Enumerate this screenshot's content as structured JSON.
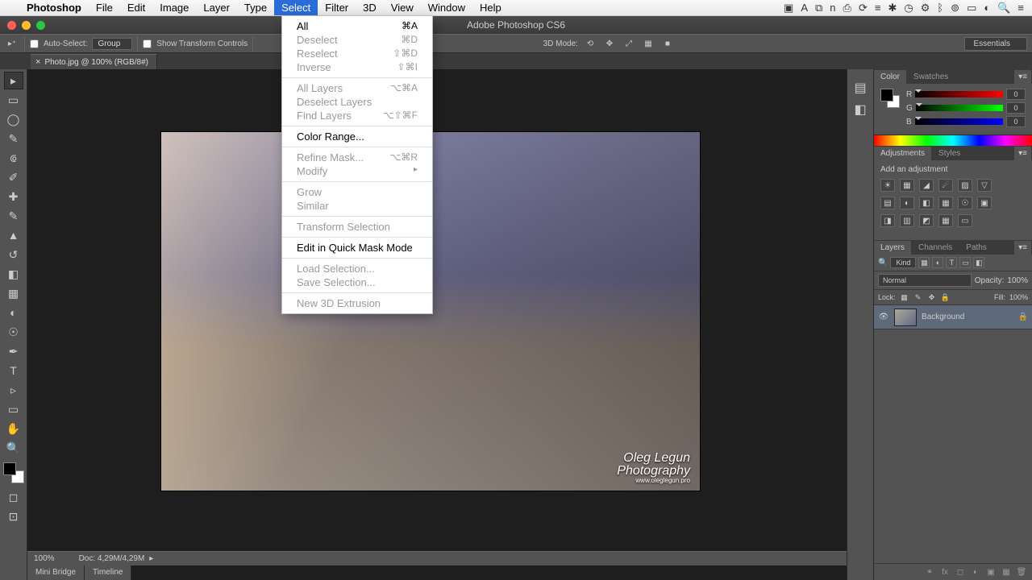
{
  "menubar": {
    "app": "Photoshop",
    "items": [
      "File",
      "Edit",
      "Image",
      "Layer",
      "Type",
      "Select",
      "Filter",
      "3D",
      "View",
      "Window",
      "Help"
    ],
    "active_index": 5
  },
  "dropdown": {
    "groups": [
      [
        {
          "label": "All",
          "shortcut": "⌘A",
          "enabled": true
        },
        {
          "label": "Deselect",
          "shortcut": "⌘D",
          "enabled": false
        },
        {
          "label": "Reselect",
          "shortcut": "⇧⌘D",
          "enabled": false
        },
        {
          "label": "Inverse",
          "shortcut": "⇧⌘I",
          "enabled": false
        }
      ],
      [
        {
          "label": "All Layers",
          "shortcut": "⌥⌘A",
          "enabled": false
        },
        {
          "label": "Deselect Layers",
          "shortcut": "",
          "enabled": false
        },
        {
          "label": "Find Layers",
          "shortcut": "⌥⇧⌘F",
          "enabled": false
        }
      ],
      [
        {
          "label": "Color Range...",
          "shortcut": "",
          "enabled": true
        }
      ],
      [
        {
          "label": "Refine Mask...",
          "shortcut": "⌥⌘R",
          "enabled": false
        },
        {
          "label": "Modify",
          "shortcut": "",
          "enabled": false,
          "submenu": true
        }
      ],
      [
        {
          "label": "Grow",
          "shortcut": "",
          "enabled": false
        },
        {
          "label": "Similar",
          "shortcut": "",
          "enabled": false
        }
      ],
      [
        {
          "label": "Transform Selection",
          "shortcut": "",
          "enabled": false
        }
      ],
      [
        {
          "label": "Edit in Quick Mask Mode",
          "shortcut": "",
          "enabled": true
        }
      ],
      [
        {
          "label": "Load Selection...",
          "shortcut": "",
          "enabled": false
        },
        {
          "label": "Save Selection...",
          "shortcut": "",
          "enabled": false
        }
      ],
      [
        {
          "label": "New 3D Extrusion",
          "shortcut": "",
          "enabled": false
        }
      ]
    ]
  },
  "window_title": "Adobe Photoshop CS6",
  "options": {
    "auto_select": "Auto-Select:",
    "group": "Group",
    "show_transform": "Show Transform Controls",
    "mode_3d": "3D Mode:",
    "workspace": "Essentials"
  },
  "document_tab": {
    "close": "×",
    "label": "Photo.jpg @ 100% (RGB/8#)"
  },
  "watermark": {
    "line1": "Oleg Legun",
    "line2": "Photography",
    "line3": "www.oleglegun.pro"
  },
  "status": {
    "zoom": "100%",
    "doc": "Doc: 4,29M/4,29M"
  },
  "bottom_tabs": [
    "Mini Bridge",
    "Timeline"
  ],
  "color_panel": {
    "tabs": [
      "Color",
      "Swatches"
    ],
    "channels": [
      {
        "n": "R",
        "v": "0"
      },
      {
        "n": "G",
        "v": "0"
      },
      {
        "n": "B",
        "v": "0"
      }
    ]
  },
  "adjust_panel": {
    "tabs": [
      "Adjustments",
      "Styles"
    ],
    "hint": "Add an adjustment"
  },
  "layers_panel": {
    "tabs": [
      "Layers",
      "Channels",
      "Paths"
    ],
    "kind": "Kind",
    "blend": "Normal",
    "opacity_label": "Opacity:",
    "opacity_val": "100%",
    "lock_label": "Lock:",
    "fill_label": "Fill:",
    "fill_val": "100%",
    "layer_name": "Background"
  }
}
